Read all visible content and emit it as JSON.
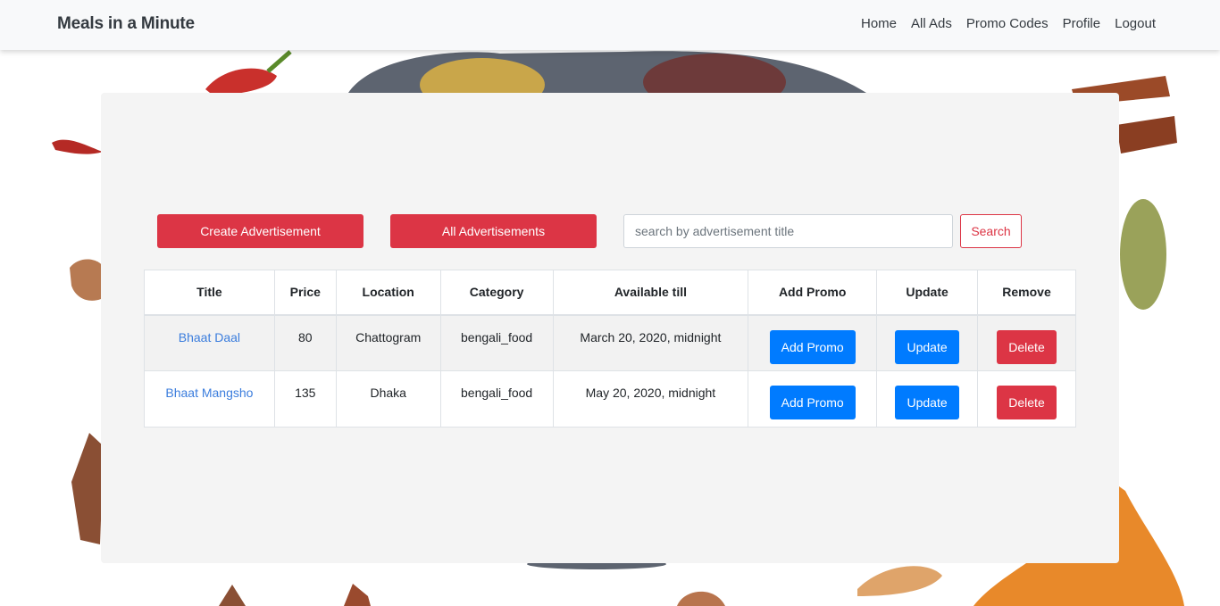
{
  "navbar": {
    "brand": "Meals in a Minute",
    "links": [
      "Home",
      "All Ads",
      "Promo Codes",
      "Profile",
      "Logout"
    ]
  },
  "toolbar": {
    "create_label": "Create Advertisement",
    "all_label": "All Advertisements",
    "search_placeholder": "search by advertisement title",
    "search_label": "Search"
  },
  "table": {
    "headers": [
      "Title",
      "Price",
      "Location",
      "Category",
      "Available till",
      "Add Promo",
      "Update",
      "Remove"
    ],
    "rows": [
      {
        "title": "Bhaat Daal",
        "price": "80",
        "location": "Chattogram",
        "category": "bengali_food",
        "available_till": "March 20, 2020, midnight",
        "promo_label": "Add Promo",
        "update_label": "Update",
        "delete_label": "Delete"
      },
      {
        "title": "Bhaat Mangsho",
        "price": "135",
        "location": "Dhaka",
        "category": "bengali_food",
        "available_till": "May 20, 2020, midnight",
        "promo_label": "Add Promo",
        "update_label": "Update",
        "delete_label": "Delete"
      }
    ]
  },
  "colors": {
    "navbar_bg": "#f8f9fa",
    "panel_bg": "#f4f4f4",
    "danger": "#dc3545",
    "primary": "#007bff",
    "link": "#3b7ddd"
  }
}
